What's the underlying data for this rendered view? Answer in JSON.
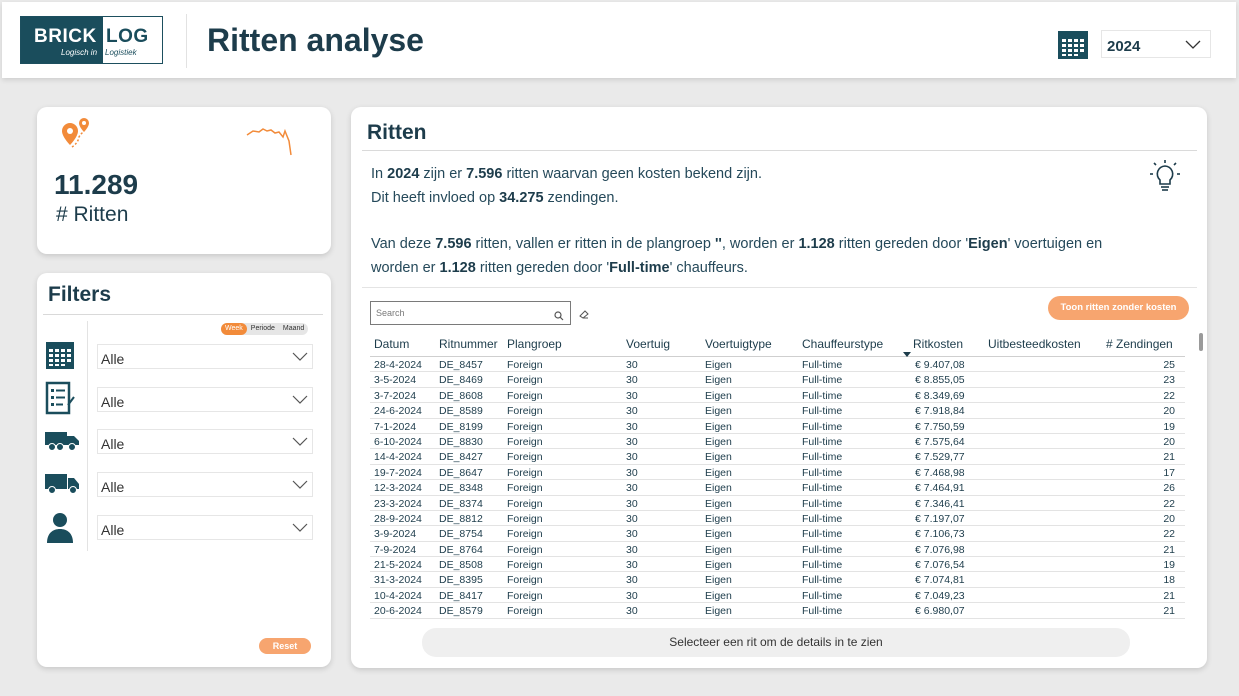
{
  "header": {
    "logo": {
      "brick": "BRICK",
      "log": "LOG",
      "tagline_left": "Logisch in",
      "tagline_right": "Logistiek"
    },
    "title": "Ritten analyse",
    "year_select": {
      "value": "2024"
    }
  },
  "kpi": {
    "value": "11.289",
    "label": "# Ritten"
  },
  "filters": {
    "title": "Filters",
    "period_toggle": [
      "Week",
      "Periode",
      "Maand"
    ],
    "active_period": "Week",
    "selects": [
      {
        "icon": "calendar-icon",
        "value": "Alle"
      },
      {
        "icon": "checklist-icon",
        "value": "Alle"
      },
      {
        "icon": "truck-icon",
        "value": "Alle"
      },
      {
        "icon": "van-icon",
        "value": "Alle"
      },
      {
        "icon": "person-icon",
        "value": "Alle"
      }
    ],
    "reset_label": "Reset"
  },
  "ritten": {
    "title": "Ritten",
    "insight": {
      "l1a": "In ",
      "l1b": "2024",
      "l1c": " zijn er ",
      "l1d": "7.596",
      "l1e": " ritten waarvan geen kosten bekend zijn.",
      "l2a": "Dit heeft invloed op ",
      "l2b": "34.275",
      "l2c": " zendingen.",
      "l3a": "Van deze ",
      "l3b": "7.596",
      "l3c": " ritten, vallen er ritten in de plangroep ",
      "l3d": "''",
      "l3e": ", worden er ",
      "l3f": "1.128",
      "l3g": " ritten gereden door '",
      "l3h": "Eigen",
      "l3i": "' voertuigen en",
      "l4a": "worden er ",
      "l4b": "1.128",
      "l4c": " ritten gereden door '",
      "l4d": "Full-time",
      "l4e": "' chauffeurs."
    },
    "search_placeholder": "Search",
    "toon_button": "Toon ritten zonder kosten",
    "columns": [
      "Datum",
      "Ritnummer",
      "Plangroep",
      "Voertuig",
      "Voertuigtype",
      "Chauffeurstype",
      "Ritkosten",
      "Uitbesteedkosten",
      "# Zendingen"
    ],
    "rows": [
      [
        "28-4-2024",
        "DE_8457",
        "Foreign",
        "30",
        "Eigen",
        "Full-time",
        "€ 9.407,08",
        "",
        "25"
      ],
      [
        "3-5-2024",
        "DE_8469",
        "Foreign",
        "30",
        "Eigen",
        "Full-time",
        "€ 8.855,05",
        "",
        "23"
      ],
      [
        "3-7-2024",
        "DE_8608",
        "Foreign",
        "30",
        "Eigen",
        "Full-time",
        "€ 8.349,69",
        "",
        "22"
      ],
      [
        "24-6-2024",
        "DE_8589",
        "Foreign",
        "30",
        "Eigen",
        "Full-time",
        "€ 7.918,84",
        "",
        "20"
      ],
      [
        "7-1-2024",
        "DE_8199",
        "Foreign",
        "30",
        "Eigen",
        "Full-time",
        "€ 7.750,59",
        "",
        "19"
      ],
      [
        "6-10-2024",
        "DE_8830",
        "Foreign",
        "30",
        "Eigen",
        "Full-time",
        "€ 7.575,64",
        "",
        "20"
      ],
      [
        "14-4-2024",
        "DE_8427",
        "Foreign",
        "30",
        "Eigen",
        "Full-time",
        "€ 7.529,77",
        "",
        "21"
      ],
      [
        "19-7-2024",
        "DE_8647",
        "Foreign",
        "30",
        "Eigen",
        "Full-time",
        "€ 7.468,98",
        "",
        "17"
      ],
      [
        "12-3-2024",
        "DE_8348",
        "Foreign",
        "30",
        "Eigen",
        "Full-time",
        "€ 7.464,91",
        "",
        "26"
      ],
      [
        "23-3-2024",
        "DE_8374",
        "Foreign",
        "30",
        "Eigen",
        "Full-time",
        "€ 7.346,41",
        "",
        "22"
      ],
      [
        "28-9-2024",
        "DE_8812",
        "Foreign",
        "30",
        "Eigen",
        "Full-time",
        "€ 7.197,07",
        "",
        "20"
      ],
      [
        "3-9-2024",
        "DE_8754",
        "Foreign",
        "30",
        "Eigen",
        "Full-time",
        "€ 7.106,73",
        "",
        "22"
      ],
      [
        "7-9-2024",
        "DE_8764",
        "Foreign",
        "30",
        "Eigen",
        "Full-time",
        "€ 7.076,98",
        "",
        "21"
      ],
      [
        "21-5-2024",
        "DE_8508",
        "Foreign",
        "30",
        "Eigen",
        "Full-time",
        "€ 7.076,54",
        "",
        "19"
      ],
      [
        "31-3-2024",
        "DE_8395",
        "Foreign",
        "30",
        "Eigen",
        "Full-time",
        "€ 7.074,81",
        "",
        "18"
      ],
      [
        "10-4-2024",
        "DE_8417",
        "Foreign",
        "30",
        "Eigen",
        "Full-time",
        "€ 7.049,23",
        "",
        "21"
      ],
      [
        "20-6-2024",
        "DE_8579",
        "Foreign",
        "30",
        "Eigen",
        "Full-time",
        "€ 6.980,07",
        "",
        "21"
      ]
    ],
    "detail_hint": "Selecteer een rit om de details in te zien"
  },
  "colors": {
    "brand": "#1a4d5c",
    "accent": "#f28b3a",
    "button": "#f7a56f"
  }
}
